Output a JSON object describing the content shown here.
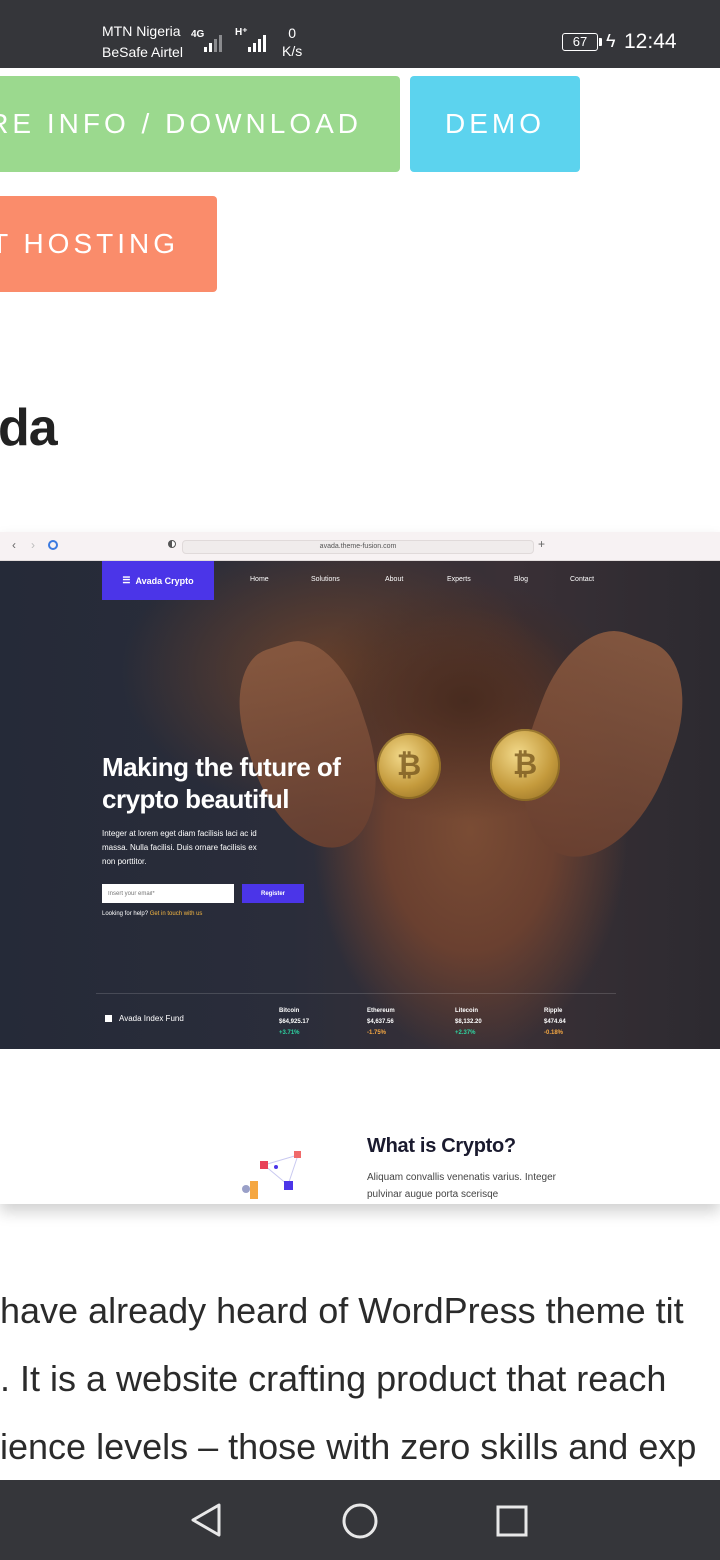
{
  "status_bar": {
    "carrier_1": "MTN Nigeria",
    "carrier_2": "BeSafe Airtel",
    "net_type_1": "4G",
    "net_type_2": "H⁺",
    "net_speed_value": "0",
    "net_speed_unit": "K/s",
    "battery": "67",
    "time": "12:44"
  },
  "buttons": {
    "download": "RE INFO / DOWNLOAD",
    "demo": "DEMO",
    "hosting": "T HOSTING"
  },
  "heading_fragment": "da",
  "screenshot": {
    "url": "avada.theme-fusion.com",
    "brand": "Avada Crypto",
    "menu": [
      "Home",
      "Solutions",
      "About",
      "Experts",
      "Blog",
      "Contact"
    ],
    "hero_title": "Making the future of crypto beautiful",
    "hero_text": "Integer at lorem eget diam facilisis laci ac id massa. Nulla facilisi. Duis ornare facilisis ex non porttitor.",
    "email_placeholder": "Insert your email*",
    "register_label": "Register",
    "help_text": "Looking for help?",
    "help_link": "Get in touch with us",
    "fund_label": "Avada Index Fund",
    "tickers": [
      {
        "name": "Bitcoin",
        "price": "$64,925.17",
        "change": "+3.71%"
      },
      {
        "name": "Ethereum",
        "price": "$4,637.56",
        "change": "-1.75%"
      },
      {
        "name": "Litecoin",
        "price": "$8,132.20",
        "change": "+2.37%"
      },
      {
        "name": "Ripple",
        "price": "$474.64",
        "change": "-0.18%"
      }
    ],
    "what_title": "What is Crypto?",
    "what_text": "Aliquam convallis venenatis varius. Integer pulvinar augue porta scerisqe"
  },
  "article_lines": [
    "have already heard of WordPress theme tit",
    ". It is a website crafting product that reach",
    "ience levels – those with zero skills and exp"
  ],
  "colors": {
    "status_bg": "#35363a",
    "download_btn": "#9bd98e",
    "demo_btn": "#5cd3ee",
    "hosting_btn": "#fa8c6b",
    "brand_purple": "#4b35e8"
  }
}
